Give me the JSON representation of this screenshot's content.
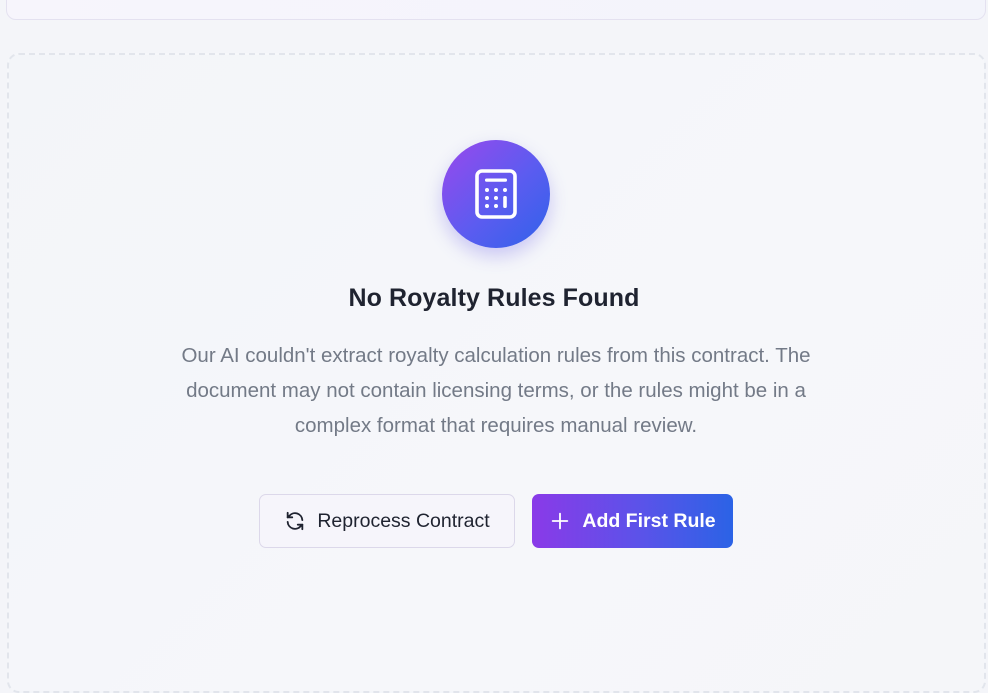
{
  "empty_state": {
    "icon": "calculator-icon",
    "title": "No Royalty Rules Found",
    "description": "Our AI couldn't extract royalty calculation rules from this contract. The document may not contain licensing terms, or the rules might be in a complex format that requires manual review."
  },
  "actions": {
    "reprocess": {
      "label": "Reprocess Contract",
      "icon": "refresh-icon"
    },
    "add_rule": {
      "label": "Add First Rule",
      "icon": "plus-icon"
    }
  },
  "colors": {
    "accent_start": "#9a48ec",
    "accent_end": "#2b63e6",
    "title_text": "#1f2330",
    "body_text": "#737a87"
  }
}
